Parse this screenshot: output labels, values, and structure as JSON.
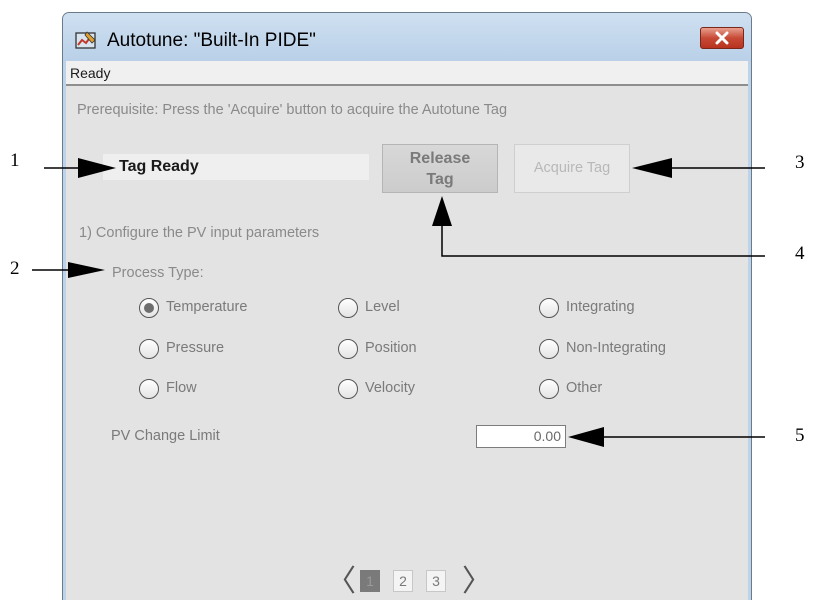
{
  "window": {
    "title": "Autotune:  \"Built-In PIDE\"",
    "status": "Ready"
  },
  "prerequisite": "Prerequisite: Press the 'Acquire' button to acquire the Autotune Tag",
  "tag_status": "Tag Ready",
  "buttons": {
    "release": "Release\nTag",
    "acquire": "Acquire Tag"
  },
  "step1": "1) Configure the PV input parameters",
  "process_type": {
    "label": "Process Type:",
    "selected": "Temperature",
    "options": [
      "Temperature",
      "Level",
      "Integrating",
      "Pressure",
      "Position",
      "Non-Integrating",
      "Flow",
      "Velocity",
      "Other"
    ]
  },
  "pv_change_limit": {
    "label": "PV Change Limit",
    "value": "0.00"
  },
  "pager": {
    "prev": "〈",
    "next": "〉",
    "pages": [
      "1",
      "2",
      "3"
    ],
    "current": "1"
  },
  "callouts": [
    "1",
    "2",
    "3",
    "4",
    "5"
  ]
}
